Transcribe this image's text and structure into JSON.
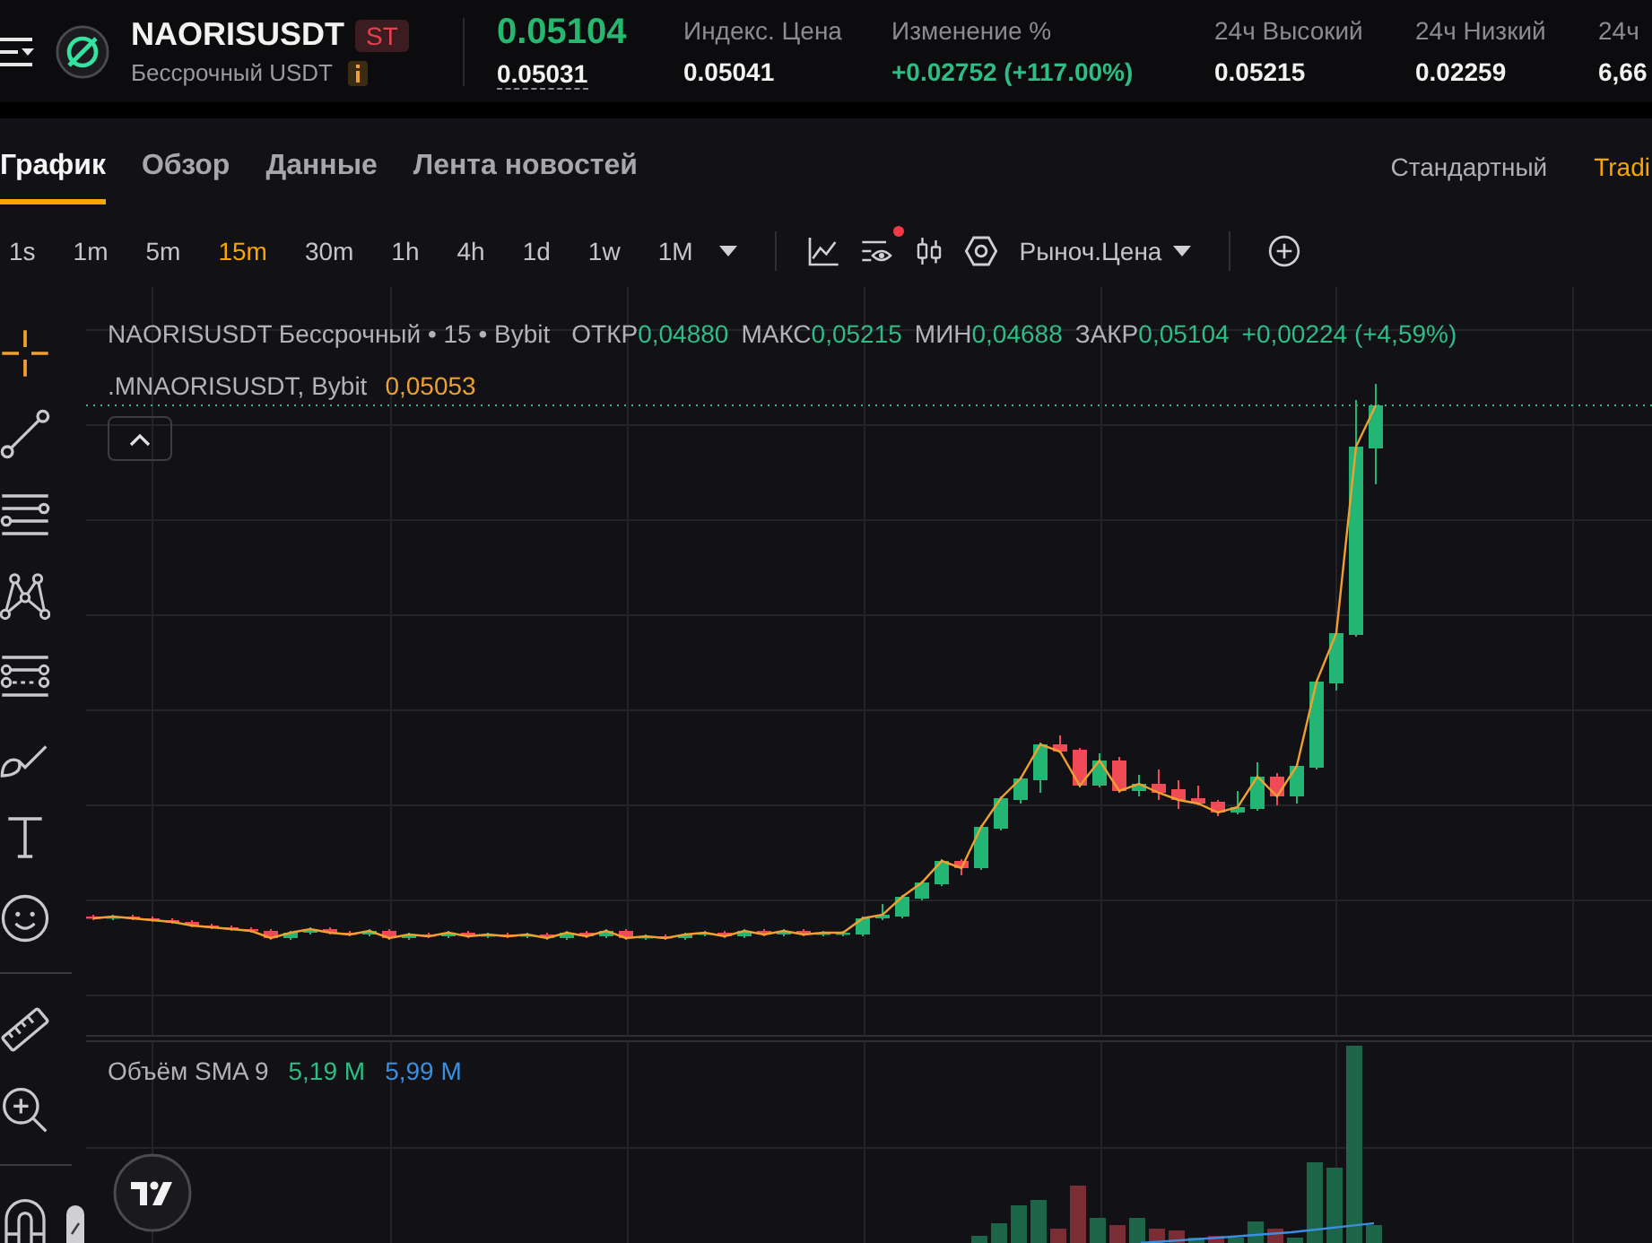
{
  "header": {
    "symbol": "NAORISUSDT",
    "badge": "ST",
    "contract": "Бессрочный USDT",
    "last_price": "0.05104",
    "mark_price": "0.05031",
    "stats": [
      {
        "label": "Индекс. Цена",
        "value": "0.05041",
        "kind": "plain"
      },
      {
        "label": "Изменение %",
        "value": "+0.02752 (+117.00%)",
        "kind": "up"
      },
      {
        "label": "24ч Высокий",
        "value": "0.05215",
        "kind": "plain"
      },
      {
        "label": "24ч Низкий",
        "value": "0.02259",
        "kind": "plain"
      },
      {
        "label": "24ч",
        "value": "6,66",
        "kind": "plain"
      }
    ]
  },
  "tabs": [
    {
      "label": "График",
      "selected": true
    },
    {
      "label": "Обзор",
      "selected": false
    },
    {
      "label": "Данные",
      "selected": false
    },
    {
      "label": "Лента новостей",
      "selected": false
    }
  ],
  "view_modes": [
    {
      "label": "Стандартный",
      "selected": false
    },
    {
      "label": "Tradi",
      "selected": true
    }
  ],
  "intervals": [
    {
      "label": "1s",
      "selected": false
    },
    {
      "label": "1m",
      "selected": false
    },
    {
      "label": "5m",
      "selected": false
    },
    {
      "label": "15m",
      "selected": true
    },
    {
      "label": "30m",
      "selected": false
    },
    {
      "label": "1h",
      "selected": false
    },
    {
      "label": "4h",
      "selected": false
    },
    {
      "label": "1d",
      "selected": false
    },
    {
      "label": "1w",
      "selected": false
    },
    {
      "label": "1M",
      "selected": false
    }
  ],
  "chart_toolbar": {
    "price_type": "Рыноч.Цена",
    "indicator_notice": true
  },
  "tools": [
    {
      "kind": "crosshair",
      "selected": true
    },
    {
      "kind": "trend-line",
      "selected": false
    },
    {
      "kind": "parallel-lines",
      "selected": false
    },
    {
      "kind": "pattern",
      "selected": false
    },
    {
      "kind": "fib-levels",
      "selected": false
    },
    {
      "kind": "brush",
      "selected": false
    },
    {
      "kind": "text",
      "selected": false
    },
    {
      "kind": "emoji",
      "selected": false
    },
    {
      "kind": "ruler",
      "selected": false
    },
    {
      "kind": "zoom",
      "selected": false
    },
    {
      "kind": "magnet",
      "selected": false
    }
  ],
  "legend": {
    "title": "NAORISUSDT Бессрочный • 15 • Bybit",
    "ohlc": [
      {
        "label": "ОТКР",
        "value": "0,04880"
      },
      {
        "label": "МАКС",
        "value": "0,05215"
      },
      {
        "label": "МИН",
        "value": "0,04688"
      },
      {
        "label": "ЗАКР",
        "value": "0,05104"
      }
    ],
    "change": "+0,00224 (+4,59%)",
    "mark": {
      "name": ".MNAORISUSDT, Bybit",
      "value": "0,05053"
    }
  },
  "volume": {
    "label": "Объём SMA 9",
    "values": [
      {
        "value": "5,19 M",
        "color": "#2ebd85"
      },
      {
        "value": "5,99 M",
        "color": "#3a8fe0"
      }
    ]
  }
}
